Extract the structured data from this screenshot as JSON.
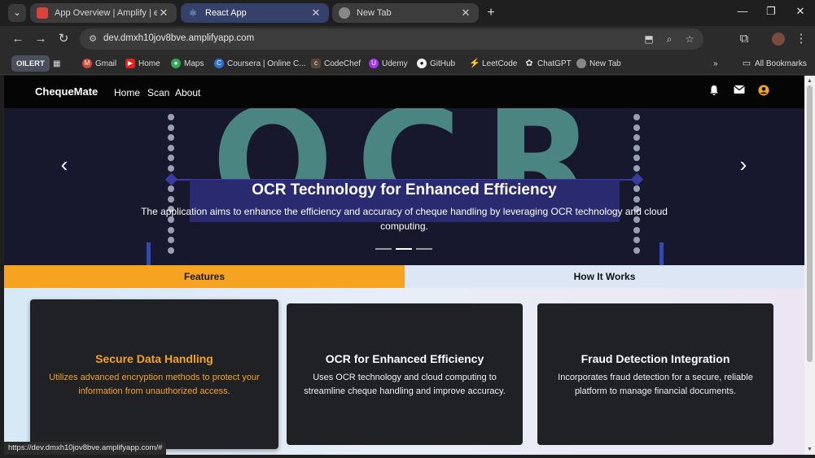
{
  "browser": {
    "tabs": [
      {
        "label": "App Overview | Amplify | eu-w",
        "favicon": "amplify-icon",
        "active": false
      },
      {
        "label": "React App",
        "favicon": "react-icon",
        "active": true
      },
      {
        "label": "New Tab",
        "favicon": "chrome-icon",
        "active": false
      }
    ],
    "url": "dev.dmxh10jov8bve.amplifyapp.com",
    "bookmarks": [
      {
        "label": "OILERT"
      },
      {
        "label": "Gmail"
      },
      {
        "label": "Home"
      },
      {
        "label": "Maps"
      },
      {
        "label": "Coursera | Online C..."
      },
      {
        "label": "CodeChef"
      },
      {
        "label": "Udemy"
      },
      {
        "label": "GitHub"
      },
      {
        "label": "LeetCode"
      },
      {
        "label": "ChatGPT"
      },
      {
        "label": "New Tab"
      }
    ],
    "all_bookmarks": "All Bookmarks",
    "status_url": "https://dev.dmxh10jov8bve.amplifyapp.com/#"
  },
  "site": {
    "brand": "ChequeMate",
    "nav": [
      "Home",
      "Scan",
      "About"
    ]
  },
  "hero": {
    "bg_text": "OCR",
    "title": "OCR Technology for Enhanced Efficiency",
    "description": "The application aims to enhance the efficiency and accuracy of cheque handling by leveraging OCR technology and cloud computing.",
    "slides": 3,
    "active_slide": 2
  },
  "tabs": {
    "features": "Features",
    "how_it_works": "How It Works"
  },
  "cards": [
    {
      "title": "Secure Data Handling",
      "description": "Utilizes advanced encryption methods to protect your information from unauthorized access."
    },
    {
      "title": "OCR for Enhanced Efficiency",
      "description": "Uses OCR technology and cloud computing to streamline cheque handling and improve accuracy."
    },
    {
      "title": "Fraud Detection Integration",
      "description": "Incorporates fraud detection for a secure, reliable platform to manage financial documents."
    }
  ],
  "colors": {
    "accent_orange": "#f5a320",
    "nav_black": "#050505",
    "card_bg": "#1f2124",
    "hero_text_teal": "#4a8582"
  }
}
